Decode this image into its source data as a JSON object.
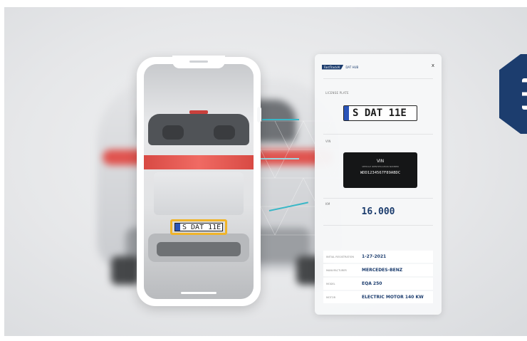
{
  "panel": {
    "header": {
      "logo_primary": "FastTrackAI",
      "logo_secondary": "DAT HUB",
      "close_icon": "x"
    },
    "license_plate": {
      "label": "LICENSE PLATE",
      "value": "S  DAT 11E"
    },
    "vin": {
      "label": "VIN",
      "box_title": "VIN",
      "box_subtitle": "VEHICLE IDENTIFICATION NUMBER",
      "value": "WDD1234567F89ABDC"
    },
    "mileage": {
      "label": "KM",
      "value": "16.000"
    },
    "details": [
      {
        "key": "INITIAL REGISTRATION",
        "value": "1-27-2021"
      },
      {
        "key": "MANUFACTURER",
        "value": "MERCEDES-BENZ"
      },
      {
        "key": "MODEL",
        "value": "EQA 250"
      },
      {
        "key": "MOTOR",
        "value": "ELECTRIC MOTOR 140 KW"
      }
    ]
  },
  "phone": {
    "plate_text": "S  DAT 11E"
  },
  "colors": {
    "brand_navy": "#1c3d6e",
    "accent_teal": "#39b7c7",
    "scan_frame": "#f0b429",
    "taillight": "#e0534e"
  },
  "icons": {
    "close": "close-icon",
    "hex_badge": "menu-hexagon-icon"
  }
}
